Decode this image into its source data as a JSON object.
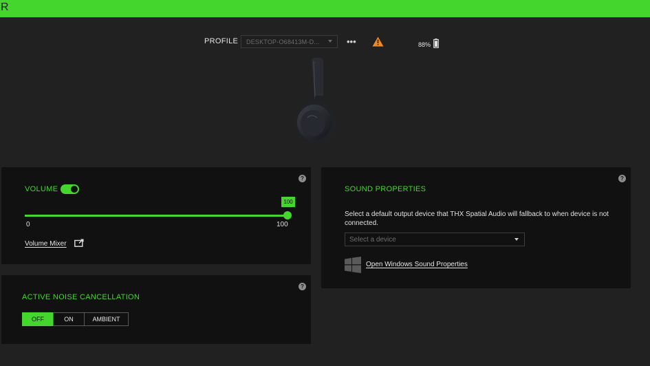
{
  "app": {
    "top_letter": "R",
    "accent_color": "#44d62c"
  },
  "header": {
    "profile_label": "PROFILE",
    "profile_value": "DESKTOP-O68413M-D...",
    "more_label": "•••",
    "battery": "88%",
    "warning_icon": "warning-triangle-icon",
    "battery_icon": "battery-icon"
  },
  "volume": {
    "title": "VOLUME",
    "enabled": true,
    "value": 100,
    "badge": "100",
    "min_label": "0",
    "max_label": "100",
    "mixer_link": "Volume Mixer",
    "help": "?"
  },
  "anc": {
    "title": "ACTIVE NOISE CANCELLATION",
    "options": [
      "OFF",
      "ON",
      "AMBIENT"
    ],
    "selected": "OFF",
    "help": "?"
  },
  "sound": {
    "title": "SOUND PROPERTIES",
    "description": "Select a default output device that THX Spatial Audio will fallback to when device is not connected.",
    "select_placeholder": "Select a device",
    "link": "Open Windows Sound Properties",
    "help": "?"
  }
}
